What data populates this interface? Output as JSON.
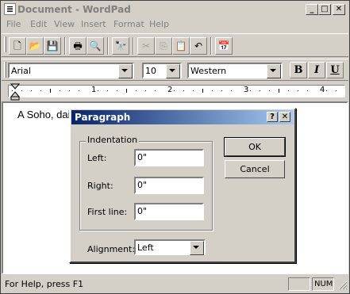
{
  "window": {
    "title": "Document - WordPad"
  },
  "menu": [
    "File",
    "Edit",
    "View",
    "Insert",
    "Format",
    "Help"
  ],
  "toolbar_icons": [
    "new-icon",
    "open-icon",
    "save-icon",
    "print-icon",
    "print-preview-icon",
    "find-icon",
    "cut-icon",
    "copy-icon",
    "paste-icon",
    "undo-icon",
    "insert-date-icon"
  ],
  "format_bar": {
    "font": "Arial",
    "size": "10",
    "script": "Western",
    "bold": "B",
    "italic": "I",
    "underline": "U"
  },
  "ruler": {
    "marks": [
      "1",
      "2",
      "3",
      "4"
    ]
  },
  "document": {
    "text": "A Soho, dai"
  },
  "dialog": {
    "title": "Paragraph",
    "help": "?",
    "close": "✕",
    "group": "Indentation",
    "left_label": "Left:",
    "left_value": "0\"",
    "right_label": "Right:",
    "right_value": "0\"",
    "first_label": "First line:",
    "first_value": "0\"",
    "alignment_label": "Alignment:",
    "alignment_value": "Left",
    "ok": "OK",
    "cancel": "Cancel"
  },
  "status": {
    "help": "For Help, press F1",
    "num": "NUM"
  },
  "colors": {
    "dialog_title": "#0a246a",
    "face": "#d4d0c8"
  }
}
